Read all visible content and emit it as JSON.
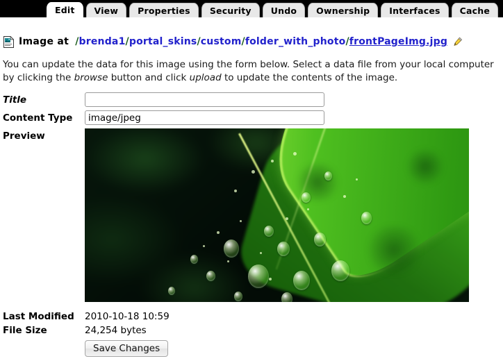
{
  "tabs": [
    {
      "label": "Edit",
      "active": true
    },
    {
      "label": "View",
      "active": false
    },
    {
      "label": "Properties",
      "active": false
    },
    {
      "label": "Security",
      "active": false
    },
    {
      "label": "Undo",
      "active": false
    },
    {
      "label": "Ownership",
      "active": false
    },
    {
      "label": "Interfaces",
      "active": false
    },
    {
      "label": "Cache",
      "active": false
    }
  ],
  "header": {
    "icon": "image-document-icon",
    "title_label": "Image at",
    "edit_icon": "pencil-icon",
    "path_segments": [
      {
        "text": "brenda1",
        "last": false
      },
      {
        "text": "portal_skins",
        "last": false
      },
      {
        "text": "custom",
        "last": false
      },
      {
        "text": "folder_with_photo",
        "last": false
      },
      {
        "text": "frontPageImg.jpg",
        "last": true
      }
    ]
  },
  "description": {
    "part1": "You can update the data for this image using the form below. Select a data file from your local computer by clicking the ",
    "em1": "browse",
    "part2": " button and click ",
    "em2": "upload",
    "part3": " to update the contents of the image."
  },
  "form": {
    "title_label": "Title",
    "title_value": "",
    "title_placeholder": "",
    "content_type_label": "Content Type",
    "content_type_value": "image/jpeg",
    "preview_label": "Preview",
    "preview_alt": "green leaf with water droplets photo"
  },
  "meta": {
    "last_modified_label": "Last Modified",
    "last_modified_value": "2010-10-18 10:59",
    "file_size_label": "File Size",
    "file_size_value": "24,254 bytes",
    "save_label": "Save Changes"
  },
  "colors": {
    "tabbar_bg": "#000000",
    "tab_inactive_bg": "#e8e8e8",
    "tab_active_bg": "#ffffff",
    "link": "#2222cc",
    "path_separator": "#1a5c1a",
    "page_bg": "#ffffff"
  }
}
